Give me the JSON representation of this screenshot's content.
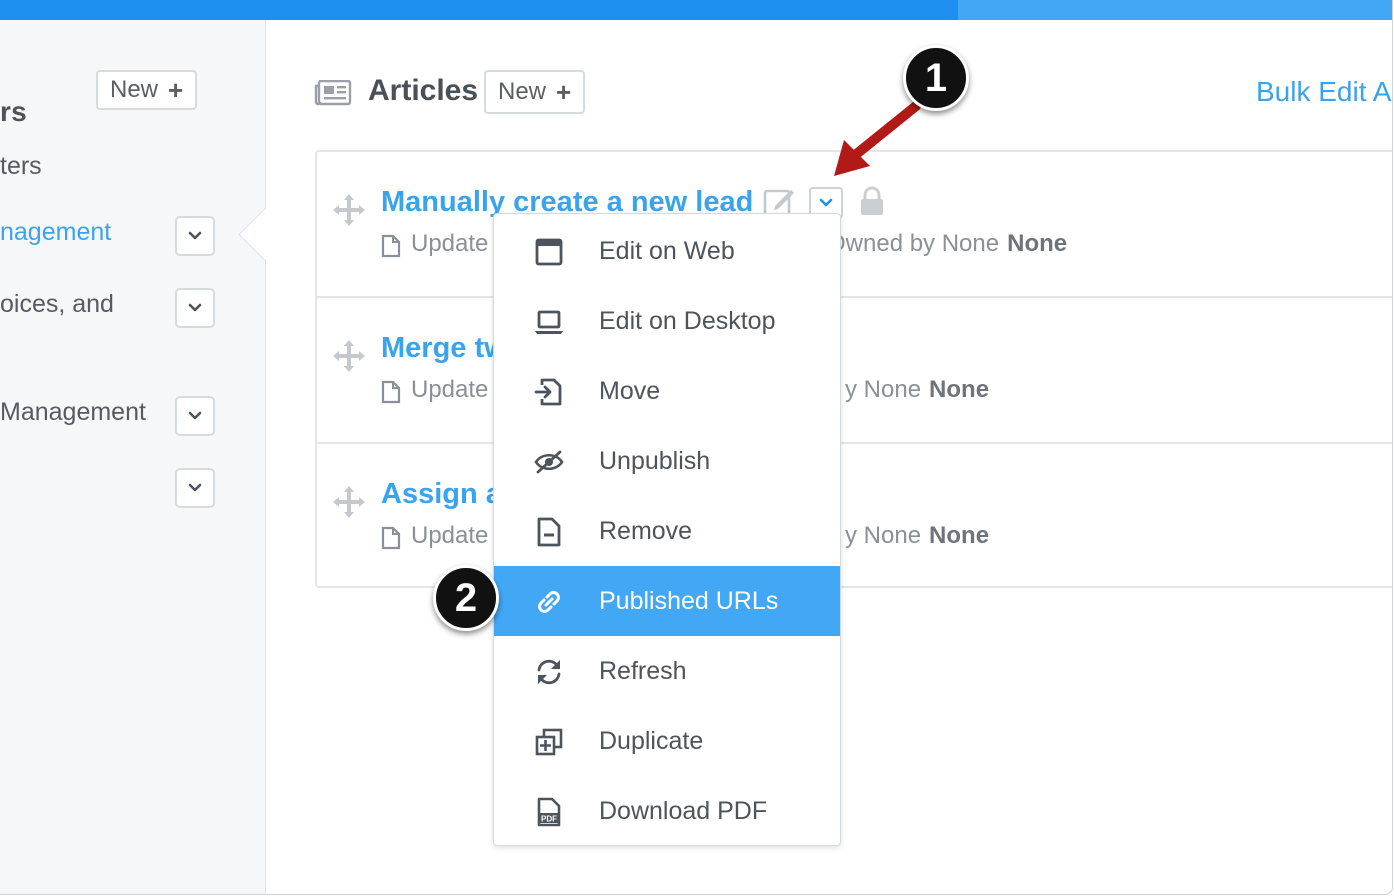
{
  "colors": {
    "accent": "#3aa3ee",
    "topbar": "#1e8ff0",
    "highlight": "#42a8f6",
    "annotation_arrow": "#b21a18"
  },
  "sidebar": {
    "title": "rs",
    "new_button": {
      "label": "New",
      "icon": "plus-icon"
    },
    "items": [
      {
        "label": "ters",
        "has_dropdown": false
      },
      {
        "label": "nagement",
        "active": true,
        "has_dropdown": true
      },
      {
        "label": "oices, and",
        "has_dropdown": true
      },
      {
        "label": " Management",
        "has_dropdown": true
      },
      {
        "label": "",
        "has_dropdown": true
      }
    ]
  },
  "header": {
    "title": "Articles",
    "new_button": {
      "label": "New",
      "icon": "plus-icon"
    },
    "bulk_edit": "Bulk Edit A"
  },
  "articles": [
    {
      "title": "Manually create a new lead",
      "updated": "Update",
      "owned": "Owned by None",
      "owner": "None"
    },
    {
      "title": "Merge tw",
      "updated": "Update",
      "owned": "y None",
      "owner": "None"
    },
    {
      "title": "Assign a",
      "updated": "Update",
      "owned": "y None",
      "owner": "None"
    }
  ],
  "menu": {
    "items": [
      {
        "label": "Edit on Web",
        "icon": "browser-window-icon"
      },
      {
        "label": "Edit on Desktop",
        "icon": "laptop-icon"
      },
      {
        "label": "Move",
        "icon": "move-into-icon"
      },
      {
        "label": "Unpublish",
        "icon": "eye-slash-icon"
      },
      {
        "label": "Remove",
        "icon": "document-minus-icon"
      },
      {
        "label": "Published URLs",
        "icon": "link-icon",
        "highlighted": true
      },
      {
        "label": "Refresh",
        "icon": "refresh-icon"
      },
      {
        "label": "Duplicate",
        "icon": "duplicate-icon"
      },
      {
        "label": "Download PDF",
        "icon": "pdf-icon"
      }
    ]
  },
  "annotations": {
    "step1": "1",
    "step2": "2"
  }
}
